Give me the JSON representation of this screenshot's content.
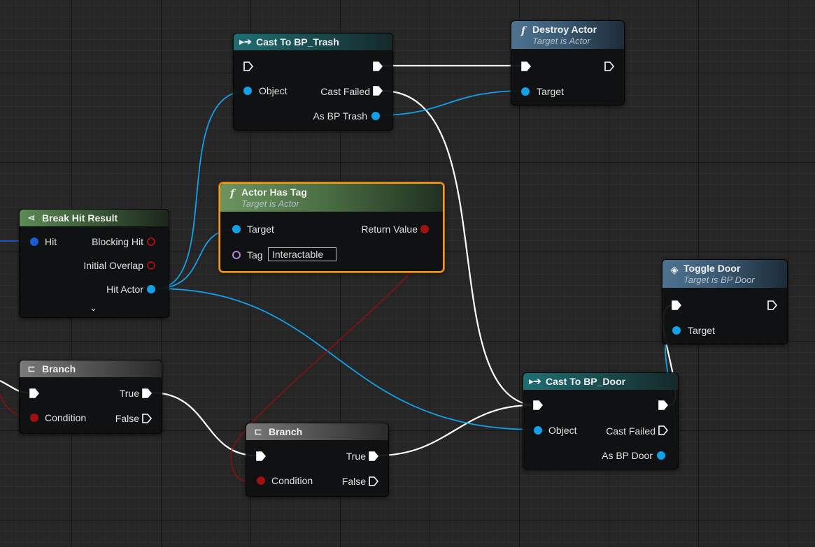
{
  "nodes": {
    "cast_trash": {
      "title": "Cast To BP_Trash",
      "pins": {
        "object": "Object",
        "cast_failed": "Cast Failed",
        "as_out": "As BP Trash"
      }
    },
    "destroy_actor": {
      "title": "Destroy Actor",
      "subtitle": "Target is Actor",
      "pins": {
        "target": "Target"
      }
    },
    "has_tag": {
      "title": "Actor Has Tag",
      "subtitle": "Target is Actor",
      "pins": {
        "target": "Target",
        "return_value": "Return Value",
        "tag": "Tag"
      },
      "tag_value": "Interactable"
    },
    "break_hit": {
      "title": "Break Hit Result",
      "pins": {
        "hit": "Hit",
        "blocking_hit": "Blocking Hit",
        "initial_overlap": "Initial Overlap",
        "hit_actor": "Hit Actor"
      }
    },
    "toggle_door": {
      "title": "Toggle Door",
      "subtitle": "Target is BP Door",
      "pins": {
        "target": "Target"
      }
    },
    "branch_left": {
      "title": "Branch",
      "pins": {
        "true": "True",
        "condition": "Condition",
        "false": "False"
      }
    },
    "cast_door": {
      "title": "Cast To BP_Door",
      "pins": {
        "object": "Object",
        "cast_failed": "Cast Failed",
        "as_out": "As BP Door"
      }
    },
    "branch_mid": {
      "title": "Branch",
      "pins": {
        "true": "True",
        "condition": "Condition",
        "false": "False"
      }
    }
  },
  "colors": {
    "exec_wire": "#ffffff",
    "object_wire": "#12a0e8",
    "bool_wire": "#8a1010",
    "selection": "#f29a1a"
  },
  "icons": {
    "cast": "cast-arrow-icon",
    "function": "function-icon",
    "break": "break-struct-icon",
    "branch": "branch-icon",
    "event": "custom-event-icon"
  }
}
